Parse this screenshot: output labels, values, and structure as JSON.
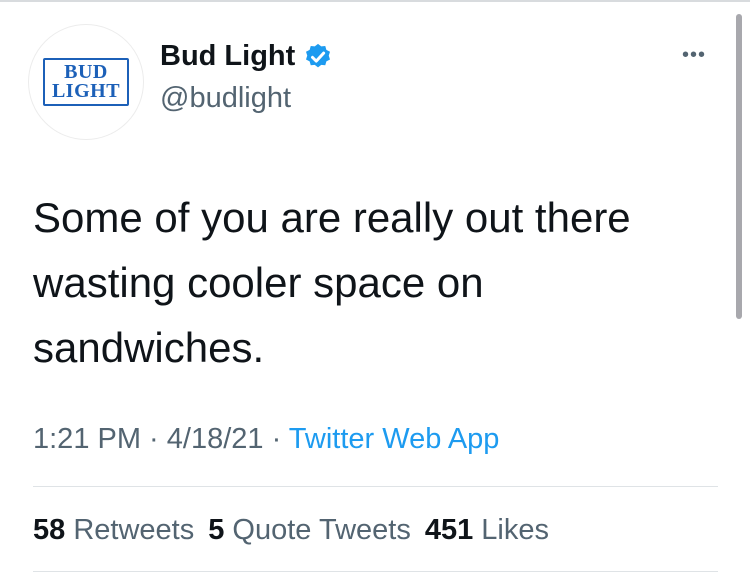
{
  "colors": {
    "accent": "#1d9bf0",
    "secondary_text": "#536471",
    "brand_blue": "#1c60b8"
  },
  "profile": {
    "avatar_logo_line1": "BUD",
    "avatar_logo_line2": "LIGHT",
    "display_name": "Bud Light",
    "verified_icon": "verified-badge-icon",
    "handle": "@budlight"
  },
  "menu": {
    "more_label": "•••"
  },
  "tweet": {
    "text": "Some of you are really out there wasting cooler space on sandwiches."
  },
  "meta": {
    "time": "1:21 PM",
    "separator": " · ",
    "date": "4/18/21",
    "source": "Twitter Web App"
  },
  "stats": {
    "retweets_count": "58",
    "retweets_label": "Retweets",
    "quotes_count": "5",
    "quotes_label": "Quote Tweets",
    "likes_count": "451",
    "likes_label": "Likes"
  }
}
